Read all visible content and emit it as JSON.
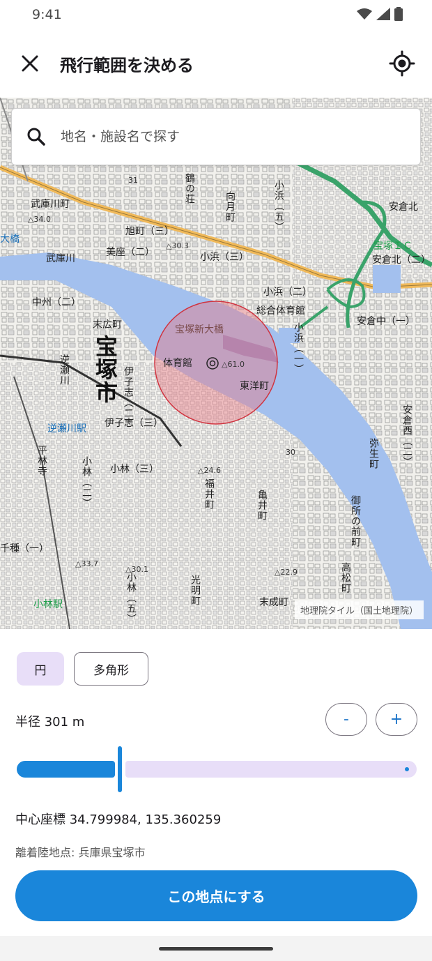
{
  "status_bar": {
    "time": "9:41"
  },
  "header": {
    "title": "飛行範囲を決める"
  },
  "search": {
    "placeholder": "地名・施設名で探す"
  },
  "map": {
    "attribution": "地理院タイル（国土地理院）",
    "labels": {
      "mukogawa_machi": "武庫川町",
      "sakaemachi": "旭町（三）",
      "mikage": "美座（二）",
      "kohama3": "小浜（三）",
      "kohama2": "小浜（二）",
      "sogo_taiikukan": "総合体育館",
      "nakasu": "中州（二）",
      "suehiro": "末広町",
      "takarazuka_shinohashi": "宝塚新大橋",
      "taiikukan": "体育館",
      "toyo_cho": "東洋町",
      "takarazuka_city": "宝塚市",
      "iko3": "伊子志（三）",
      "sakasegawa_station": "逆瀬川駅",
      "kobayashi3": "小林（三）",
      "mukogawa_river": "武庫川",
      "ohashi": "大橋",
      "ankurakita": "安倉北",
      "ankurakita2": "安倉北（二）",
      "takarazuka_ic": "宝塚ＩＣ",
      "ankuranaka": "安倉中（一）",
      "kobayashi_station": "小林駅",
      "suenari": "末成町",
      "chigusa": "千種（一）",
      "elevation_61": "△61.0",
      "elevation_30_3": "△30.3",
      "elevation_24_6": "△24.6",
      "elevation_33_7": "△33.7",
      "elevation_30_1": "△30.1",
      "elevation_22_9": "△22.9",
      "elevation_34_0": "△34.0",
      "tick_30": "30",
      "tick_31": "31",
      "v_tsurunoso": "鶴の荘",
      "v_mukaimachi": "向月町",
      "v_kohama5": "小浜（五）",
      "v_kohama1": "小浜（一）",
      "v_sakasegawa": "逆瀬川",
      "v_iko2": "伊子志（二）",
      "v_hirabayashi": "平林寺",
      "v_kobayashi2": "小林（二）",
      "v_fukuicho": "福井町",
      "v_kameicho": "亀井町",
      "v_kobayashi5": "小林（五）",
      "v_komyocho": "光明町",
      "v_yayoicho": "弥生町",
      "v_gosho": "御所の前町",
      "v_takamatsu": "高松町",
      "v_ankuranishi": "安倉西（二）"
    }
  },
  "shape_tabs": {
    "circle": "円",
    "polygon": "多角形"
  },
  "radius": {
    "label": "半径 301 m",
    "minus": "-",
    "plus": "+",
    "slider_fraction": 0.26
  },
  "center": {
    "label": "中心座標 34.799984, 135.360259"
  },
  "takeoff": {
    "label": "離着陸地点: 兵庫県宝塚市"
  },
  "confirm": {
    "label": "この地点にする"
  },
  "colors": {
    "accent": "#1a86da",
    "chip_selected": "#e8def8",
    "range_fill": "#e87a85",
    "river": "#a3c0ee"
  },
  "icons": {
    "close": "close-icon",
    "locate": "my-location-icon",
    "search": "search-icon",
    "wifi": "wifi-icon",
    "signal": "signal-icon",
    "battery": "battery-icon"
  }
}
